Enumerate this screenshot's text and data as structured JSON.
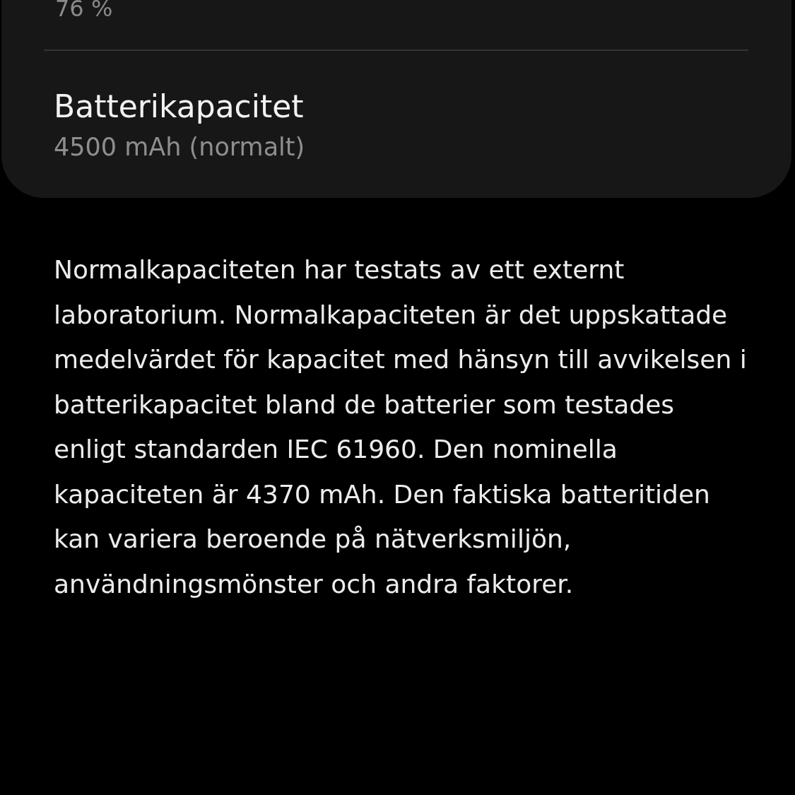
{
  "level_card": {
    "value": "76 %"
  },
  "capacity_card": {
    "title": "Batterikapacitet",
    "value": "4500 mAh (normalt)"
  },
  "description": "Normalkapaciteten har testats av ett externt laboratorium. Normalkapaciteten är det uppskattade medelvärdet för kapacitet med hänsyn till avvikelsen i batterikapacitet bland de batterier som testades enligt standarden IEC 61960. Den nominella kapaciteten är 4370 mAh. Den faktiska batteritiden kan variera beroende på nätverksmiljön, användningsmönster och andra faktorer."
}
